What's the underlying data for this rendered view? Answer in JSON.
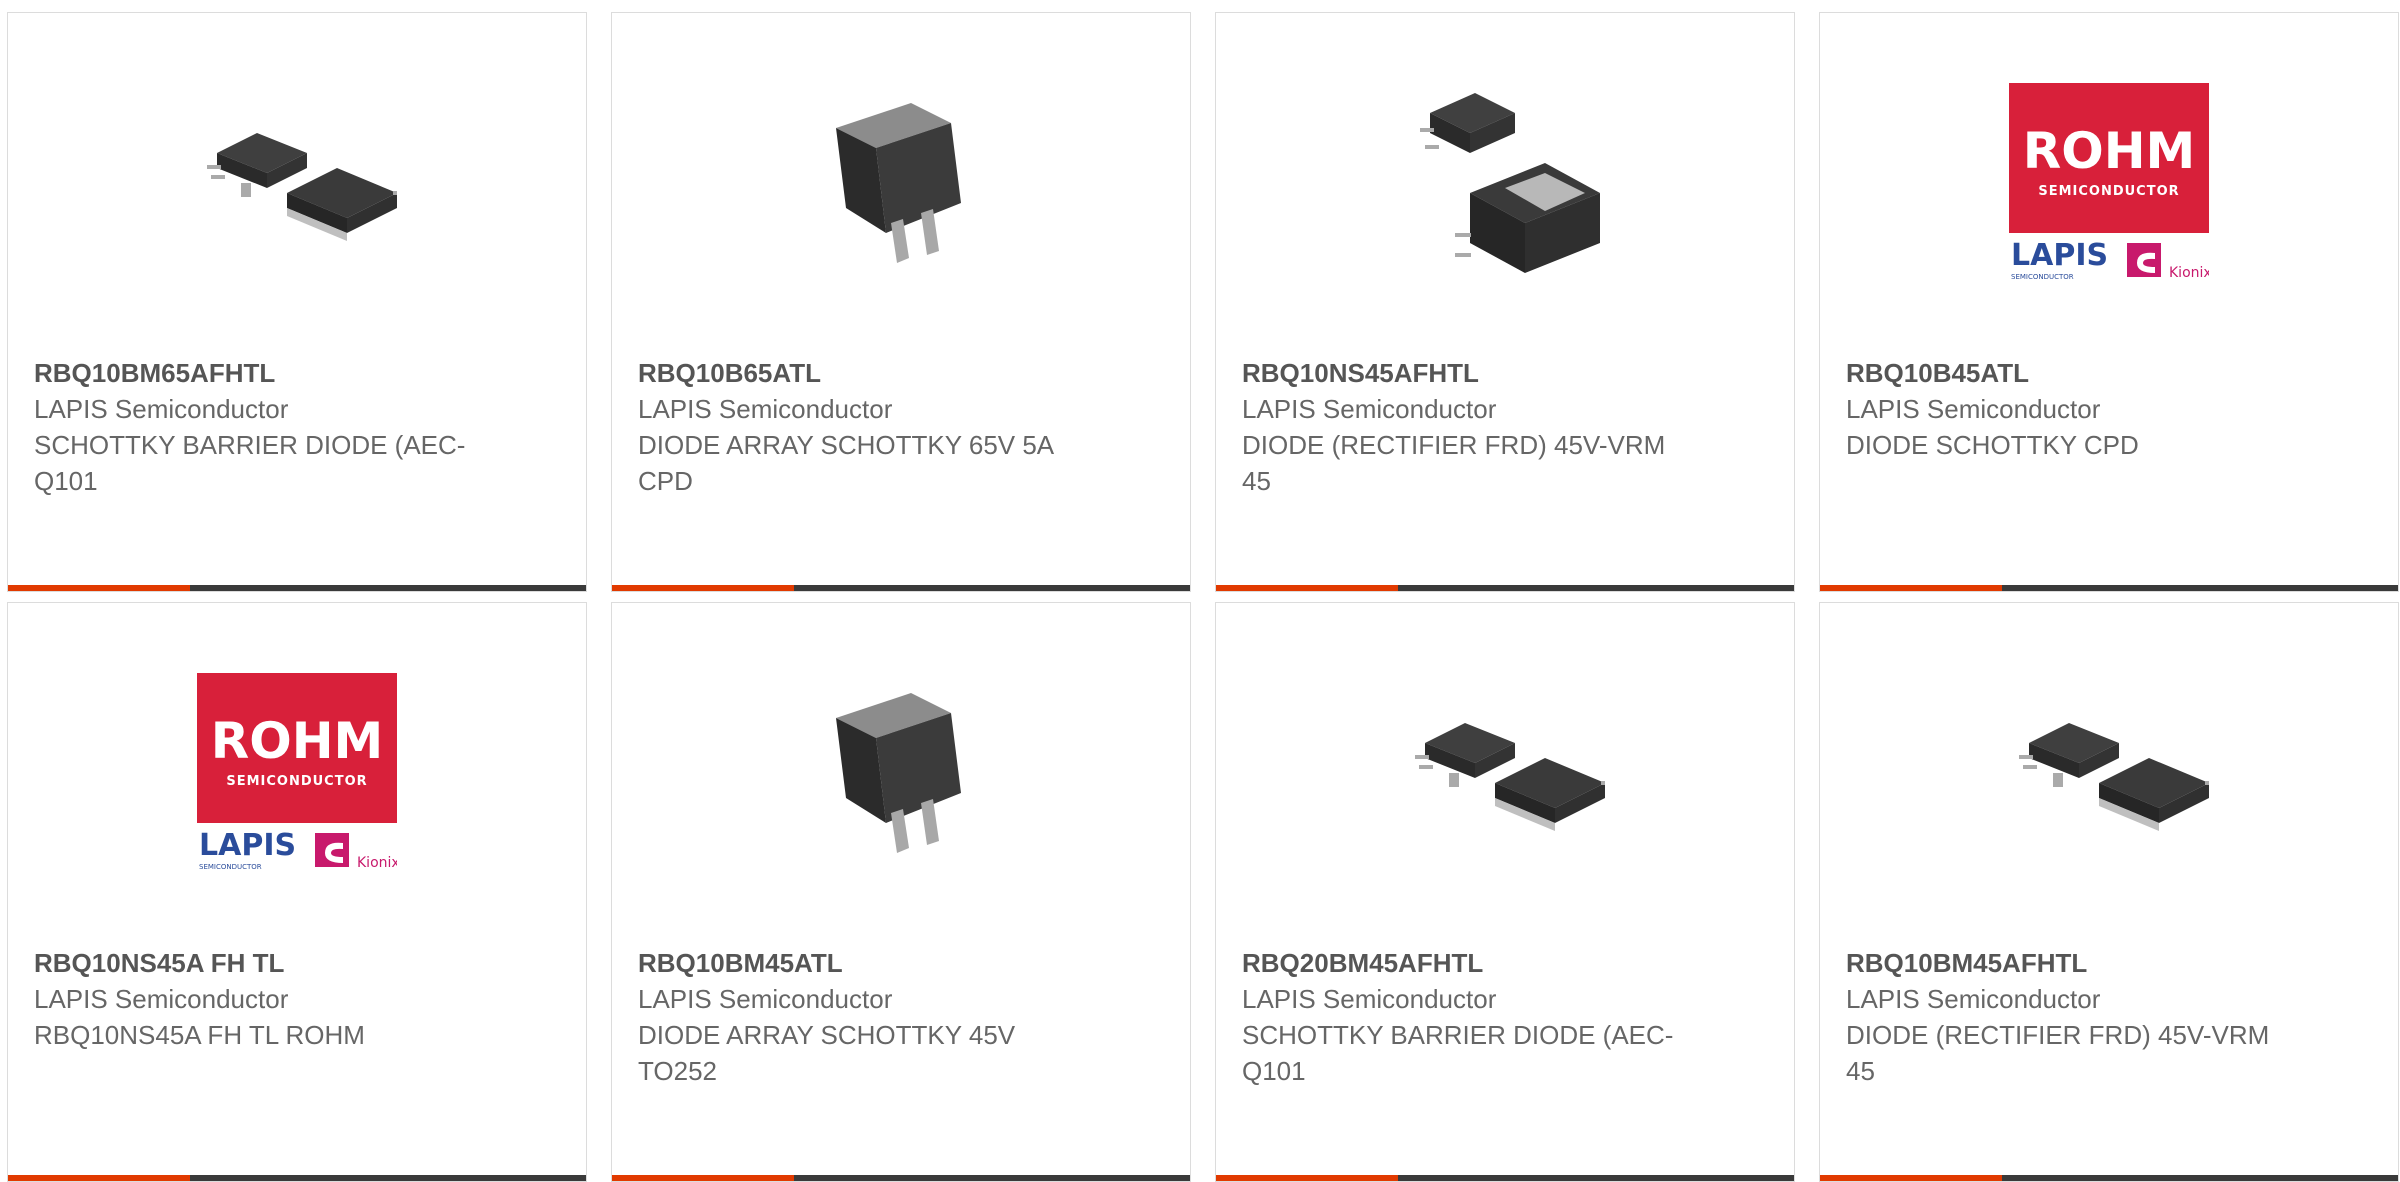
{
  "products": [
    {
      "part": "RBQ10BM65AFHTL",
      "manufacturer": "LAPIS Semiconductor",
      "description": "SCHOTTKY BARRIER DIODE (AEC-Q101",
      "image": "dpak-pair-image"
    },
    {
      "part": "RBQ10B65ATL",
      "manufacturer": "LAPIS Semiconductor",
      "description": "DIODE ARRAY SCHOTTKY 65V 5A CPD",
      "image": "cpd-package-image"
    },
    {
      "part": "RBQ10NS45AFHTL",
      "manufacturer": "LAPIS Semiconductor",
      "description": "DIODE (RECTIFIER FRD) 45V-VRM 45",
      "image": "dpak-top-bottom-image"
    },
    {
      "part": "RBQ10B45ATL",
      "manufacturer": "LAPIS Semiconductor",
      "description": "DIODE SCHOTTKY CPD",
      "image": "rohm-logo-image"
    },
    {
      "part": "RBQ10NS45A FH TL",
      "manufacturer": "LAPIS Semiconductor",
      "description": "RBQ10NS45A FH TL ROHM",
      "image": "rohm-logo-image"
    },
    {
      "part": "RBQ10BM45ATL",
      "manufacturer": "LAPIS Semiconductor",
      "description": "DIODE ARRAY SCHOTTKY 45V TO252",
      "image": "cpd-package-image"
    },
    {
      "part": "RBQ20BM45AFHTL",
      "manufacturer": "LAPIS Semiconductor",
      "description": "SCHOTTKY BARRIER DIODE (AEC-Q101",
      "image": "dpak-pair-image"
    },
    {
      "part": "RBQ10BM45AFHTL",
      "manufacturer": "LAPIS Semiconductor",
      "description": "DIODE (RECTIFIER FRD) 45V-VRM 45",
      "image": "dpak-pair-image"
    }
  ],
  "logo": {
    "brand": "ROHM",
    "sub": "SEMICONDUCTOR",
    "lapis": "LAPIS",
    "lapis_sub": "SEMICONDUCTOR",
    "kionix": "Kionix"
  },
  "colors": {
    "accent": "#e13a00",
    "bar": "#3a3a3a",
    "rohm_red": "#d8203a",
    "lapis_blue": "#2a4c9b",
    "kionix_magenta": "#c8196c"
  }
}
